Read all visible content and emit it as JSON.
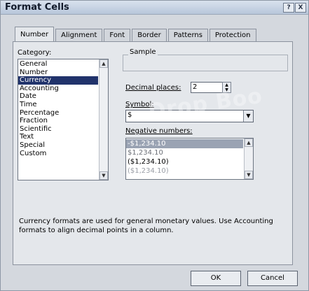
{
  "window": {
    "title": "Format Cells",
    "help_button": "?",
    "close_button": "X"
  },
  "tabs": [
    {
      "label": "Number",
      "active": true
    },
    {
      "label": "Alignment",
      "active": false
    },
    {
      "label": "Font",
      "active": false
    },
    {
      "label": "Border",
      "active": false
    },
    {
      "label": "Patterns",
      "active": false
    },
    {
      "label": "Protection",
      "active": false
    }
  ],
  "category": {
    "label": "Category:",
    "items": [
      "General",
      "Number",
      "Currency",
      "Accounting",
      "Date",
      "Time",
      "Percentage",
      "Fraction",
      "Scientific",
      "Text",
      "Special",
      "Custom"
    ],
    "selected": "Currency"
  },
  "sample": {
    "label": "Sample",
    "value": ""
  },
  "decimal_places": {
    "label": "Decimal places:",
    "value": "2"
  },
  "symbol": {
    "label": "Symbol:",
    "value": "$"
  },
  "negative_numbers": {
    "label": "Negative numbers:",
    "items": [
      "-$1,234.10",
      "$1,234.10",
      "($1,234.10)",
      "($1,234.10)"
    ],
    "item_colors": [
      "#ffffff",
      "#6b6f76",
      "#000000",
      "#9a9ea6"
    ],
    "selected_index": 0
  },
  "description": "Currency formats are used for general monetary values.  Use Accounting formats to align decimal points in a column.",
  "buttons": {
    "ok": "OK",
    "cancel": "Cancel"
  },
  "watermark": "Drop Boo"
}
